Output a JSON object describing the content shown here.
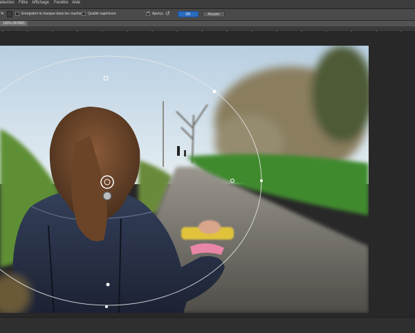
{
  "menubar": {
    "items": [
      "élection",
      "Filtre",
      "Affichage",
      "Fenêtre",
      "Aide"
    ]
  },
  "options": {
    "tool_value": "%",
    "save_mask_label": "Enregistrer le masque dans les couches",
    "quality_label": "Qualité supérieure",
    "preview_label": "Aperçu",
    "ok_label": "OK",
    "cancel_label": "Annuler"
  },
  "document": {
    "tab_label": "100% (RVB/8)"
  },
  "colors": {
    "accent": "#2a6cc0",
    "panel": "#4a4a4a",
    "background": "#282828"
  }
}
